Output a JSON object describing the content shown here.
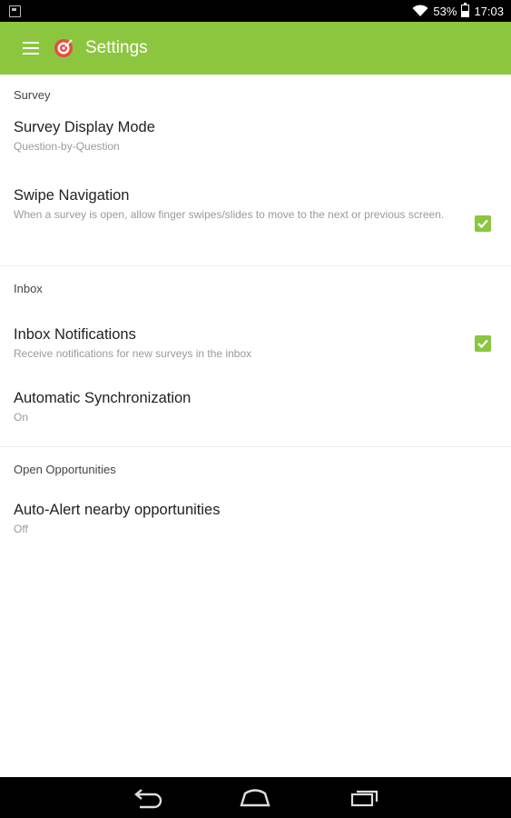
{
  "status_bar": {
    "battery": "53%",
    "time": "17:03",
    "icons": [
      "notification-icon",
      "wifi-icon",
      "battery-icon"
    ]
  },
  "app_bar": {
    "title": "Settings",
    "menu_icon": "hamburger-menu-icon",
    "logo_icon": "app-logo-icon",
    "color": "#8cc63f"
  },
  "sections": {
    "survey": {
      "header": "Survey",
      "display_mode": {
        "title": "Survey Display Mode",
        "summary": "Question-by-Question"
      },
      "swipe": {
        "title": "Swipe Navigation",
        "summary": "When a survey is open, allow finger swipes/slides to move to the next or previous screen.",
        "checked": true
      }
    },
    "inbox": {
      "header": "Inbox",
      "notifications": {
        "title": "Inbox Notifications",
        "summary": "Receive notifications for new surveys in the inbox",
        "checked": true
      },
      "sync": {
        "title": "Automatic Synchronization",
        "summary": "On"
      }
    },
    "opportunities": {
      "header": "Open Opportunities",
      "auto_alert": {
        "title": "Auto-Alert nearby opportunities",
        "summary": "Off"
      }
    }
  },
  "nav_bar": {
    "icons": [
      "back-icon",
      "home-icon",
      "recents-icon"
    ]
  }
}
